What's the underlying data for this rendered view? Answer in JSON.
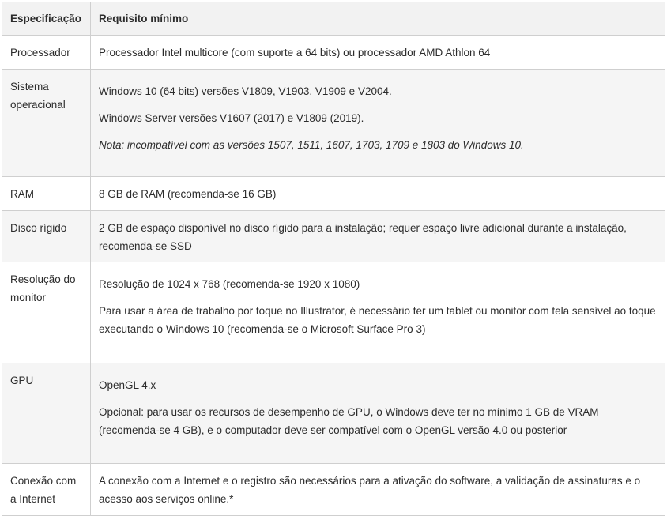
{
  "header": {
    "spec": "Especificação",
    "req": "Requisito mínimo"
  },
  "rows": [
    {
      "label": "Processador",
      "lines": [
        "Processador Intel multicore (com suporte a 64 bits) ou processador AMD Athlon 64"
      ]
    },
    {
      "label": "Sistema operacional",
      "lines": [
        "Windows 10 (64 bits) versões V1809, V1903, V1909 e V2004.",
        "Windows Server versões V1607 (2017) e V1809 (2019).",
        "Nota: incompatível com as versões 1507, 1511, 1607, 1703, 1709 e 1803 do Windows 10."
      ]
    },
    {
      "label": "RAM",
      "lines": [
        "8 GB de RAM (recomenda-se 16 GB)"
      ]
    },
    {
      "label": "Disco rígido",
      "lines": [
        "2 GB de espaço disponível no disco rígido para a instalação; requer espaço livre adicional durante a instalação, recomenda-se SSD"
      ]
    },
    {
      "label": "Resolução do monitor",
      "lines": [
        "Resolução de 1024 x 768 (recomenda-se 1920 x 1080)",
        "Para usar a área de trabalho por toque no Illustrator, é necessário ter um tablet ou monitor com tela sensível ao toque executando o Windows 10 (recomenda-se o Microsoft Surface Pro 3)"
      ]
    },
    {
      "label": "GPU",
      "lines": [
        "OpenGL 4.x",
        "Opcional: para usar os recursos de desempenho de GPU, o Windows deve ter no mínimo 1 GB de VRAM (recomenda-se 4 GB), e o computador deve ser compatível com o OpenGL versão 4.0 ou posterior"
      ]
    },
    {
      "label": "Conexão com a Internet",
      "lines": [
        "A conexão com a Internet e o registro são necessários para a ativação do software, a validação de assinaturas e o acesso aos serviços online.*"
      ]
    }
  ]
}
